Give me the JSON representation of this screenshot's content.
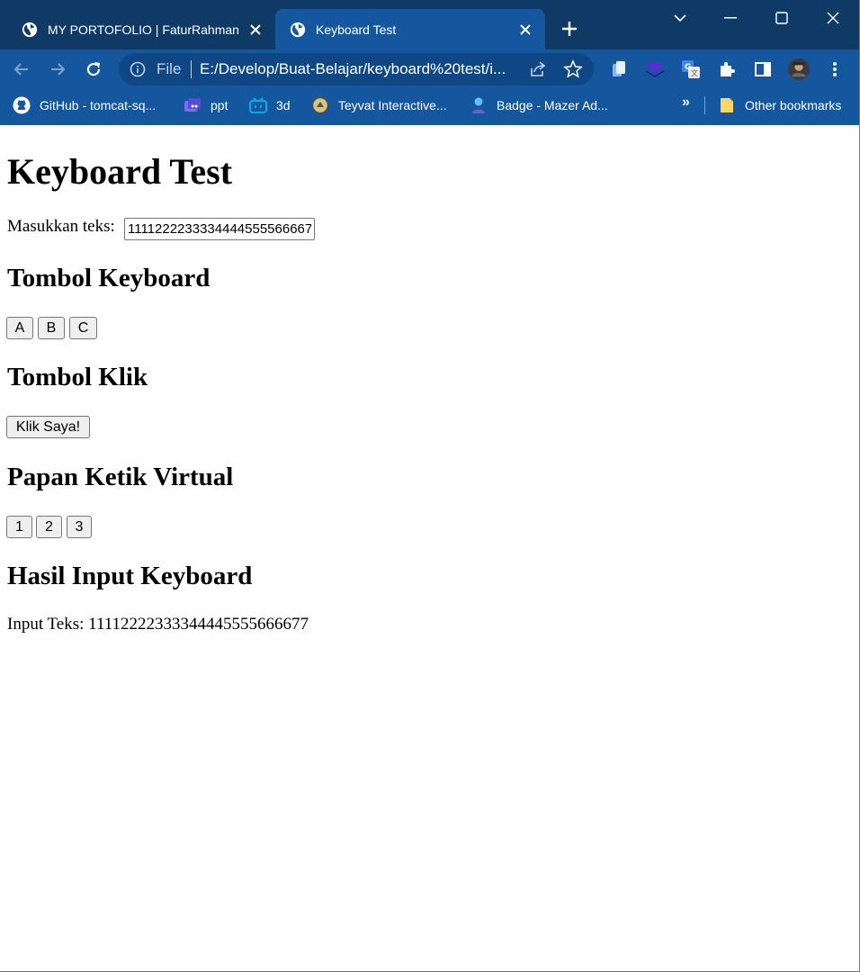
{
  "browser": {
    "tabs": [
      {
        "title": "MY PORTOFOLIO | FaturRahman",
        "active": false
      },
      {
        "title": "Keyboard Test",
        "active": true
      }
    ],
    "address": {
      "scheme_label": "File",
      "url": "E:/Develop/Buat-Belajar/keyboard%20test/i..."
    },
    "bookmarks": [
      {
        "label": "GitHub - tomcat-sq...",
        "icon": "github-icon"
      },
      {
        "label": "ppt",
        "icon": "ppt-bookmark-icon"
      },
      {
        "label": "3d",
        "icon": "bilibili-icon"
      },
      {
        "label": "Teyvat Interactive...",
        "icon": "teyvat-map-icon"
      },
      {
        "label": "Badge - Mazer Ad...",
        "icon": "mazer-icon"
      }
    ],
    "bookmarks_overflow": "»",
    "other_bookmarks": "Other bookmarks",
    "colors": {
      "tabstrip": "#0f3a66",
      "toolbar": "#15579e",
      "omnibox": "#0e4783"
    }
  },
  "page": {
    "title": "Keyboard Test",
    "input_label": "Masukkan teks:",
    "input_value": "11112222333344445555666677",
    "sections": {
      "keyboard": "Tombol Keyboard",
      "click": "Tombol Klik",
      "virtual": "Papan Ketik Virtual",
      "result": "Hasil Input Keyboard"
    },
    "keyboard_buttons": [
      "A",
      "B",
      "C"
    ],
    "click_button": "Klik Saya!",
    "virtual_buttons": [
      "1",
      "2",
      "3"
    ],
    "result_text": "Input Teks: 11112222333344445555666677"
  }
}
